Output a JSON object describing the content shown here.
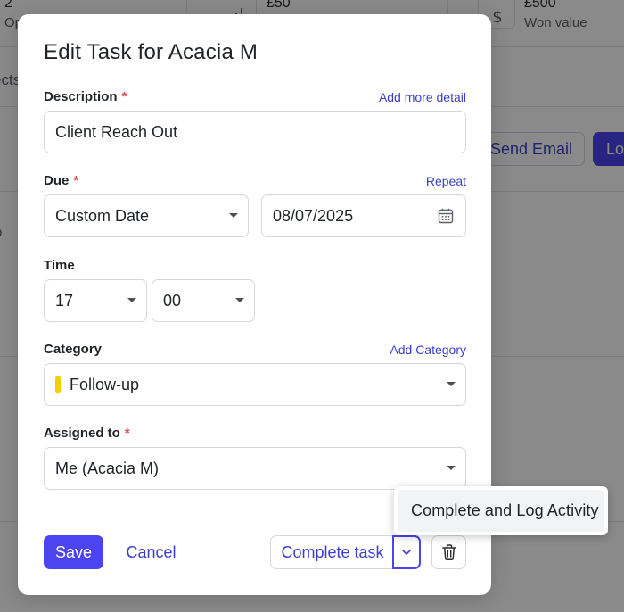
{
  "background": {
    "stat_count": "2",
    "stat_count_label": "Op",
    "stat_amount": "£50",
    "stat_won": "£500",
    "stat_won_label": "Won value",
    "tab_fragment": "ects",
    "row_fragment": "o",
    "send_email": "Send Email",
    "log_button": "Lo"
  },
  "modal": {
    "title": "Edit Task for Acacia M",
    "description": {
      "label": "Description",
      "required_mark": "*",
      "link": "Add more detail",
      "value": "Client Reach Out"
    },
    "due": {
      "label": "Due",
      "required_mark": "*",
      "link": "Repeat",
      "type_value": "Custom Date",
      "date_value": "08/07/2025"
    },
    "time": {
      "label": "Time",
      "hour": "17",
      "minute": "00"
    },
    "category": {
      "label": "Category",
      "link": "Add Category",
      "value": "Follow-up",
      "swatch_color": "#f1d000"
    },
    "assigned": {
      "label": "Assigned to",
      "required_mark": "*",
      "value": "Me (Acacia M)"
    },
    "footer": {
      "save": "Save",
      "cancel": "Cancel",
      "complete": "Complete task"
    }
  },
  "popover": {
    "item": "Complete and Log Activity"
  },
  "colors": {
    "accent": "#4b44f0",
    "link": "#3b3fc9",
    "required": "#e5484d"
  }
}
